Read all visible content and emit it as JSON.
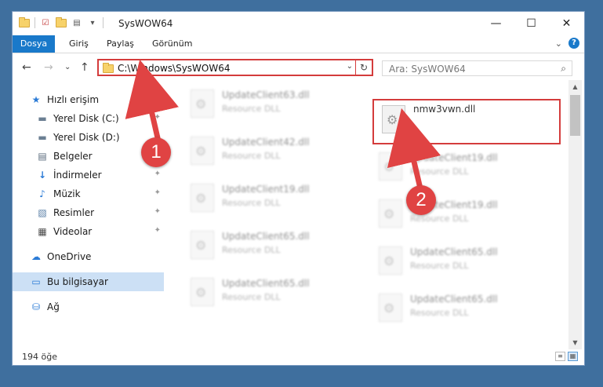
{
  "window": {
    "title": "SysWOW64",
    "controls": {
      "minimize": "—",
      "maximize": "☐",
      "close": "✕"
    }
  },
  "ribbon": {
    "tabs": [
      "Dosya",
      "Giriş",
      "Paylaş",
      "Görünüm"
    ],
    "help": "?",
    "expand": "⌄"
  },
  "navbar": {
    "back": "←",
    "forward": "→",
    "recent": "⌄",
    "up": "↑",
    "address": "C:\\Windows\\SysWOW64",
    "address_dropdown": "⌄",
    "refresh": "↻",
    "search_placeholder": "Ara: SysWOW64",
    "search_icon": "⌕"
  },
  "sidebar": {
    "items": [
      {
        "label": "Hızlı erişim",
        "icon": "★"
      },
      {
        "label": "Yerel Disk (C:)",
        "icon": "▬",
        "pinned": true
      },
      {
        "label": "Yerel Disk (D:)",
        "icon": "▬",
        "pinned": true
      },
      {
        "label": "Belgeler",
        "icon": "▤",
        "pinned": true
      },
      {
        "label": "İndirmeler",
        "icon": "↓",
        "pinned": true
      },
      {
        "label": "Müzik",
        "icon": "♪",
        "pinned": true
      },
      {
        "label": "Resimler",
        "icon": "▧",
        "pinned": true
      },
      {
        "label": "Videolar",
        "icon": "▦",
        "pinned": true
      },
      {
        "label": "OneDrive",
        "icon": "☁"
      },
      {
        "label": "Bu bilgisayar",
        "icon": "▭",
        "selected": true
      },
      {
        "label": "Ağ",
        "icon": "⛁"
      }
    ],
    "pin_glyph": "📌"
  },
  "files": {
    "highlighted": {
      "name": "nmw3vwn.dll"
    },
    "blurred": [
      {
        "name": "UpdateClient63.dll",
        "type": "Resource DLL"
      },
      {
        "name": "UpdateClient42.dll",
        "type": "Resource DLL"
      },
      {
        "name": "UpdateClient19.dll",
        "type": "Resource DLL"
      },
      {
        "name": "UpdateClient19.dll",
        "type": "Resource DLL"
      },
      {
        "name": "UpdateClient19.dll",
        "type": "Resource DLL"
      },
      {
        "name": "UpdateClient65.dll",
        "type": "Resource DLL"
      },
      {
        "name": "UpdateClient65.dll",
        "type": "Resource DLL"
      },
      {
        "name": "UpdateClient65.dll",
        "type": "Resource DLL"
      },
      {
        "name": "UpdateClient65.dll",
        "type": "Resource DLL"
      }
    ]
  },
  "status": {
    "count": "194 öğe"
  },
  "annotations": {
    "marker1": "1",
    "marker2": "2"
  },
  "colors": {
    "accent": "#1979ca",
    "highlight": "#d43c3c",
    "selected": "#cce0f5"
  }
}
